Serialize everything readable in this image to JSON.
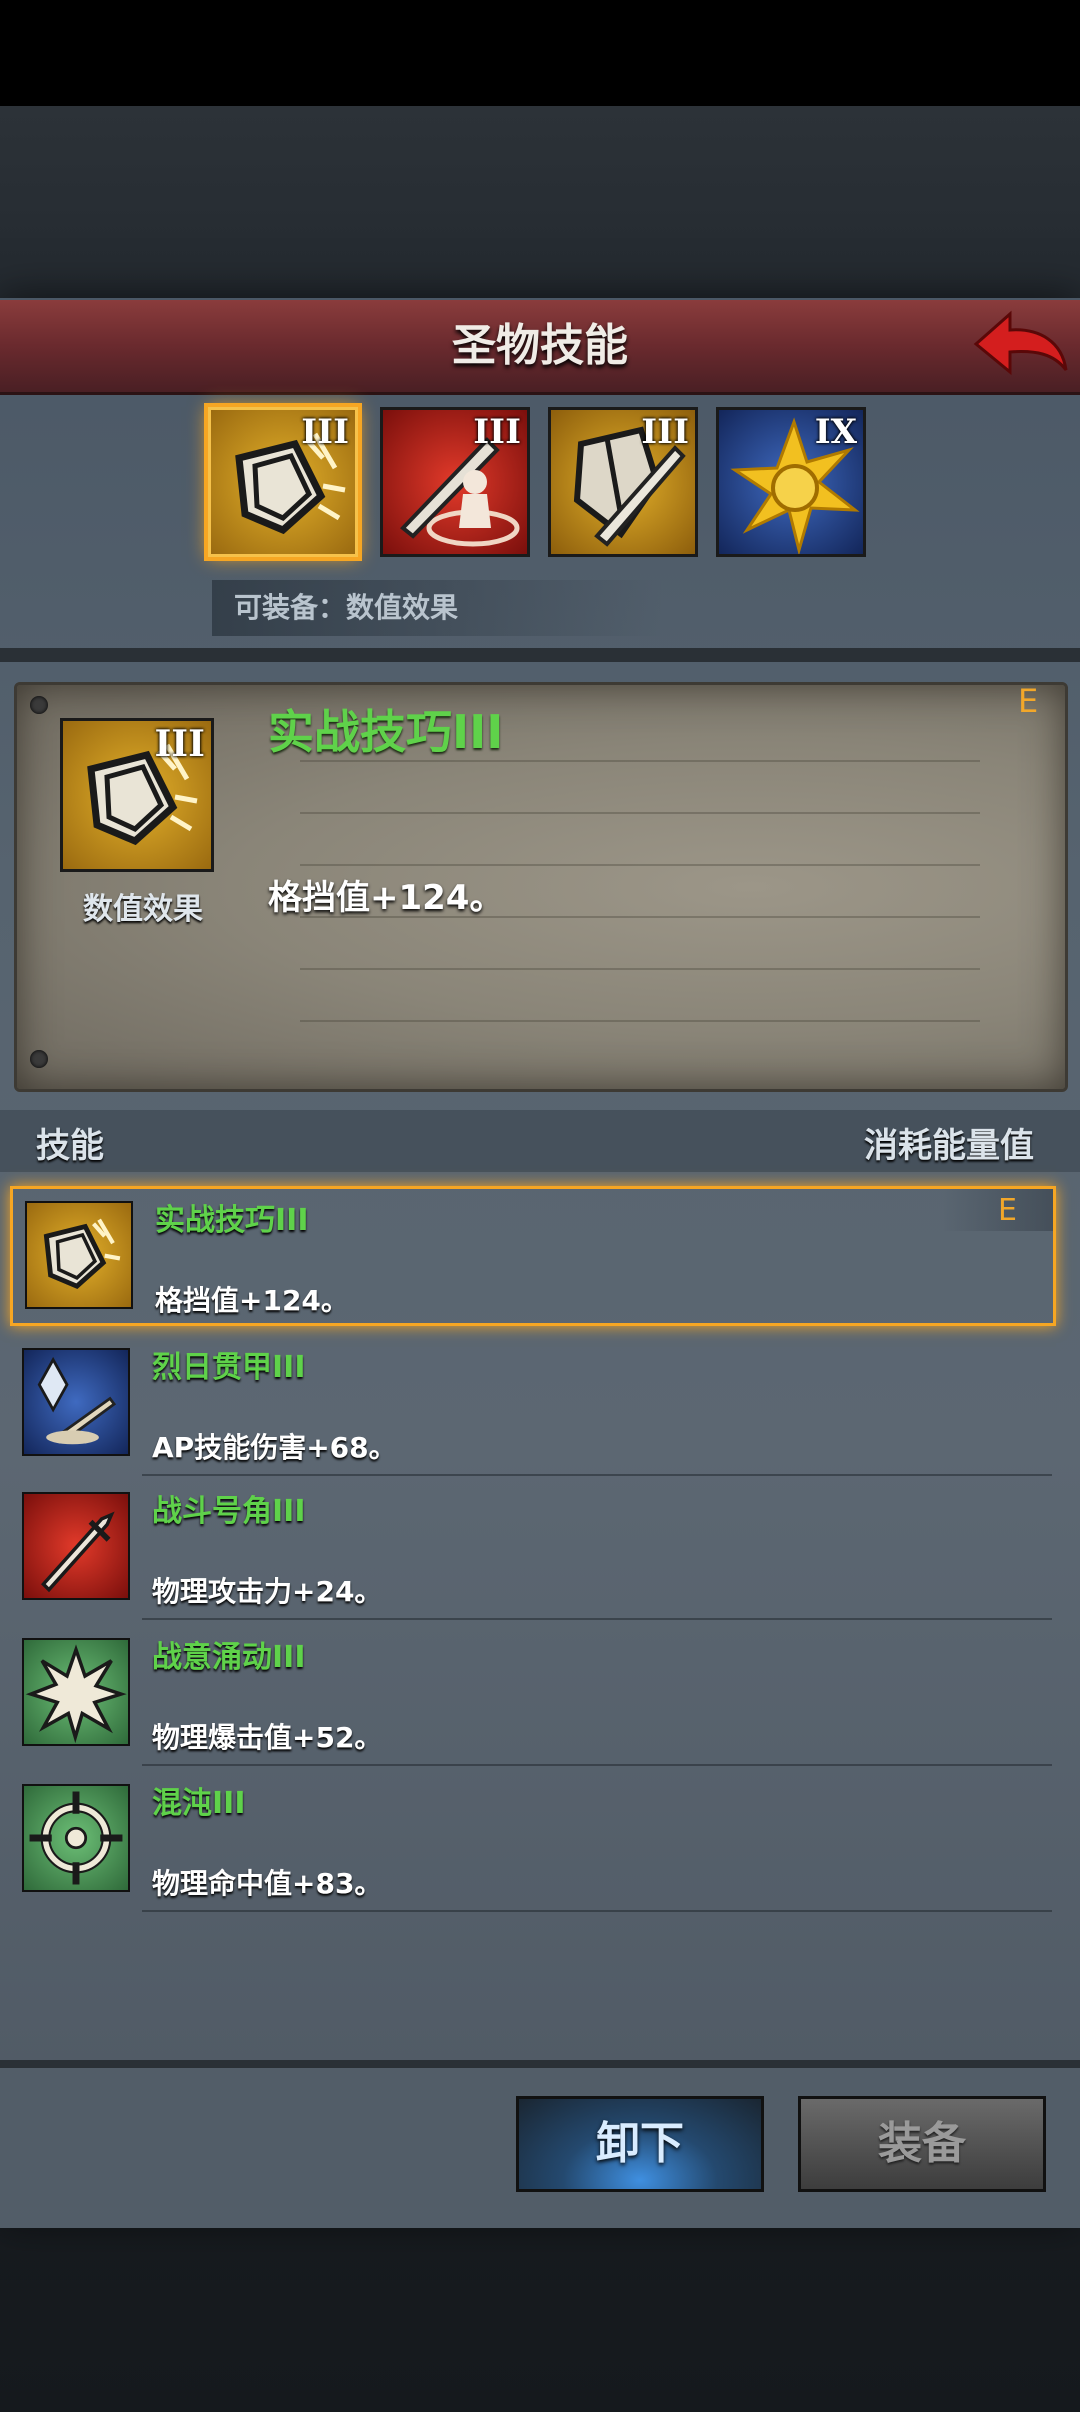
{
  "header": {
    "title": "圣物技能"
  },
  "tabs": [
    {
      "level": "III",
      "icon": "shield-break-icon",
      "color": "#d19a1a",
      "active": true
    },
    {
      "level": "III",
      "icon": "sword-aura-icon",
      "color": "#c0231e"
    },
    {
      "level": "III",
      "icon": "shield-sword-icon",
      "color": "#c9931c"
    },
    {
      "level": "IX",
      "icon": "sun-burst-icon",
      "color": "#2a4a9a"
    }
  ],
  "equip_hint": "可装备：数值效果",
  "detail": {
    "level": "III",
    "category": "数值效果",
    "name": "实战技巧III",
    "desc": "格挡值+124。",
    "equipped_mark": "E"
  },
  "list_header": {
    "skill": "技能",
    "cost": "消耗能量值"
  },
  "skills": [
    {
      "name": "实战技巧III",
      "desc": "格挡值+124。",
      "equipped": "E",
      "icon": "shield-break-icon",
      "color": "#d19a1a"
    },
    {
      "name": "烈日贯甲III",
      "desc": "AP技能伤害+68。",
      "icon": "crystal-sword-icon",
      "color": "#2a4a9a"
    },
    {
      "name": "战斗号角III",
      "desc": "物理攻击力+24。",
      "icon": "sword-icon",
      "color": "#c0231e"
    },
    {
      "name": "战意涌动III",
      "desc": "物理爆击值+52。",
      "icon": "starburst-icon",
      "color": "#4f9a5a"
    },
    {
      "name": "混沌III",
      "desc": "物理命中值+83。",
      "icon": "crosshair-icon",
      "color": "#4f9a5a"
    }
  ],
  "buttons": {
    "unequip": "卸下",
    "equip": "装备"
  }
}
